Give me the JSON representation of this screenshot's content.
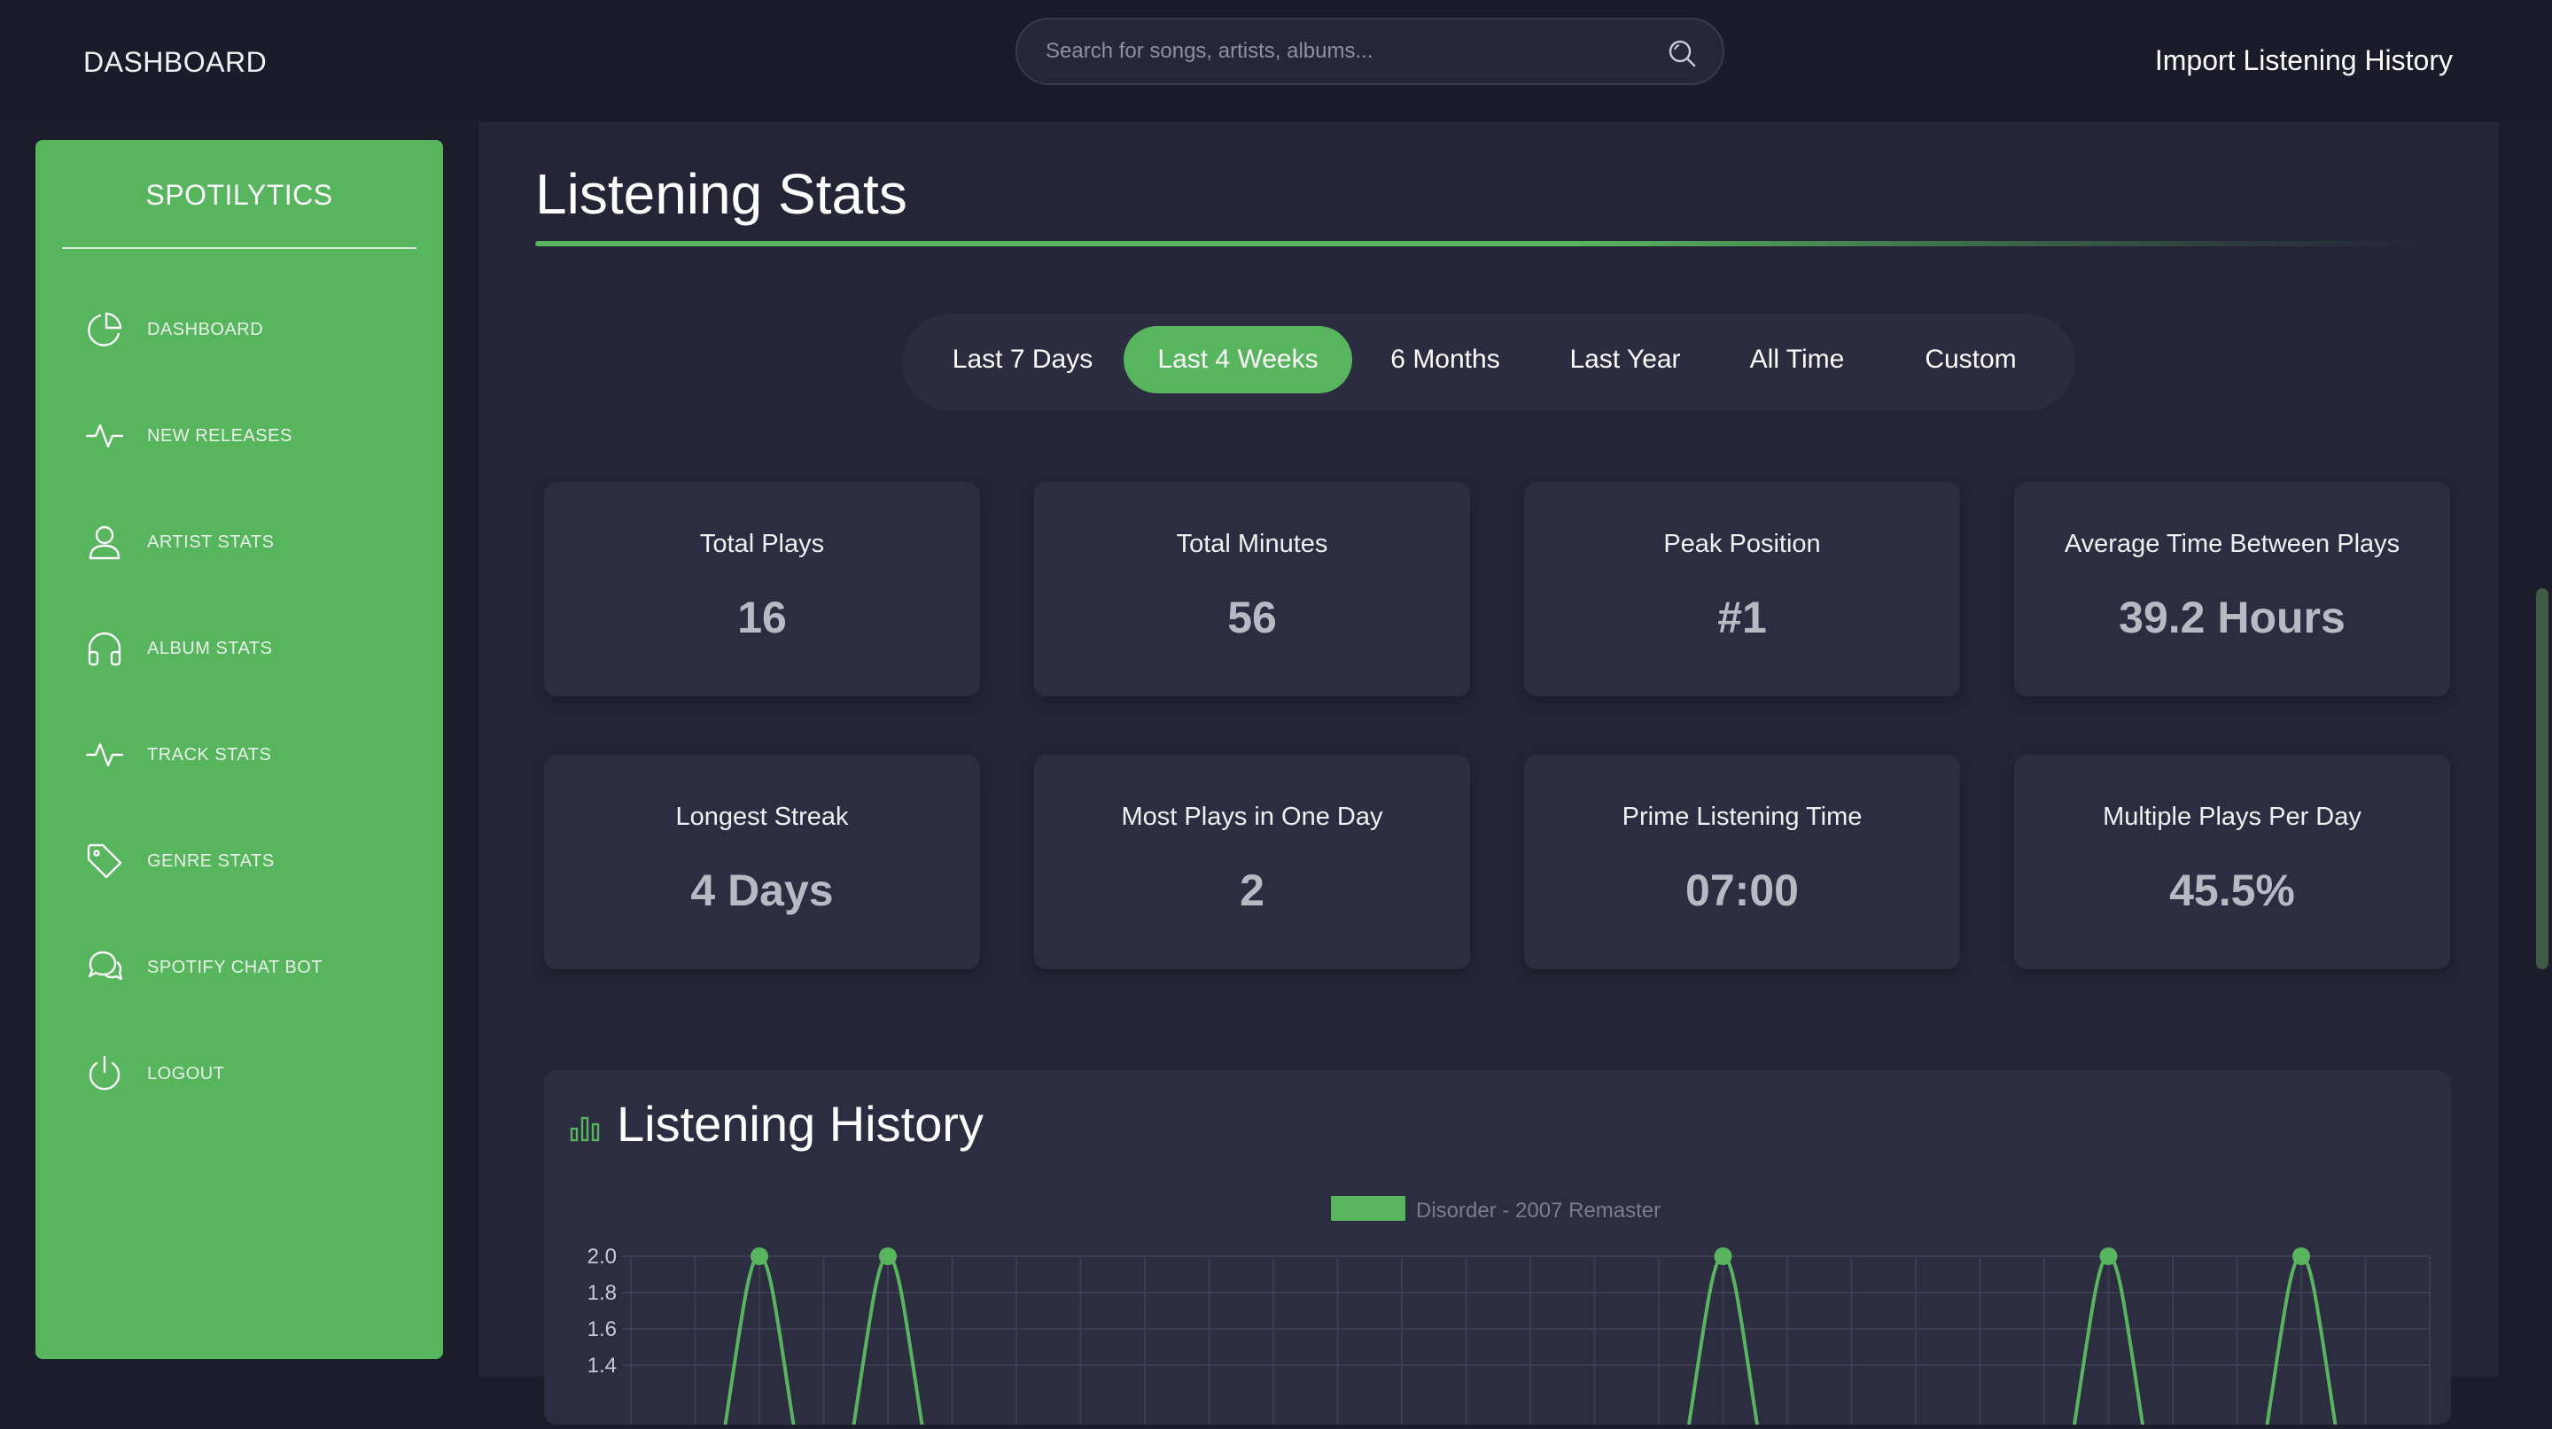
{
  "header": {
    "title": "DASHBOARD",
    "search_placeholder": "Search for songs, artists, albums...",
    "import_label": "Import Listening History"
  },
  "sidebar": {
    "brand": "SPOTILYTICS",
    "items": [
      {
        "label": "DASHBOARD",
        "icon": "pie-chart-icon"
      },
      {
        "label": "NEW RELEASES",
        "icon": "activity-icon"
      },
      {
        "label": "ARTIST STATS",
        "icon": "user-icon"
      },
      {
        "label": "ALBUM STATS",
        "icon": "headphones-icon"
      },
      {
        "label": "TRACK STATS",
        "icon": "activity-icon"
      },
      {
        "label": "GENRE STATS",
        "icon": "tag-icon"
      },
      {
        "label": "SPOTIFY CHAT BOT",
        "icon": "chat-icon"
      },
      {
        "label": "LOGOUT",
        "icon": "power-icon"
      }
    ]
  },
  "main": {
    "title": "Listening Stats",
    "ranges": [
      "Last 7 Days",
      "Last 4 Weeks",
      "6 Months",
      "Last Year",
      "All Time",
      "Custom"
    ],
    "active_range": "Last 4 Weeks",
    "stats": [
      {
        "label": "Total Plays",
        "value": "16"
      },
      {
        "label": "Total Minutes",
        "value": "56"
      },
      {
        "label": "Peak Position",
        "value": "#1"
      },
      {
        "label": "Average Time Between Plays",
        "value": "39.2 Hours"
      },
      {
        "label": "Longest Streak",
        "value": "4 Days"
      },
      {
        "label": "Most Plays in One Day",
        "value": "2"
      },
      {
        "label": "Prime Listening Time",
        "value": "07:00"
      },
      {
        "label": "Multiple Plays Per Day",
        "value": "45.5%"
      }
    ],
    "history_title": "Listening History"
  },
  "colors": {
    "accent": "#57b55e",
    "background": "#1c1c2b",
    "card": "#2d2d42"
  },
  "chart_data": {
    "type": "line",
    "title": "",
    "xlabel": "",
    "ylabel": "",
    "ylim": [
      1.4,
      2.0
    ],
    "yticks": [
      "2.0",
      "1.8",
      "1.6",
      "1.4"
    ],
    "series": [
      {
        "name": "Disorder - 2007 Remaster",
        "peak_x_positions": [
          2,
          4,
          17,
          23,
          26
        ],
        "peak_value": 2.0
      }
    ],
    "x_count": 29,
    "grid": true,
    "legend": "top-center"
  }
}
